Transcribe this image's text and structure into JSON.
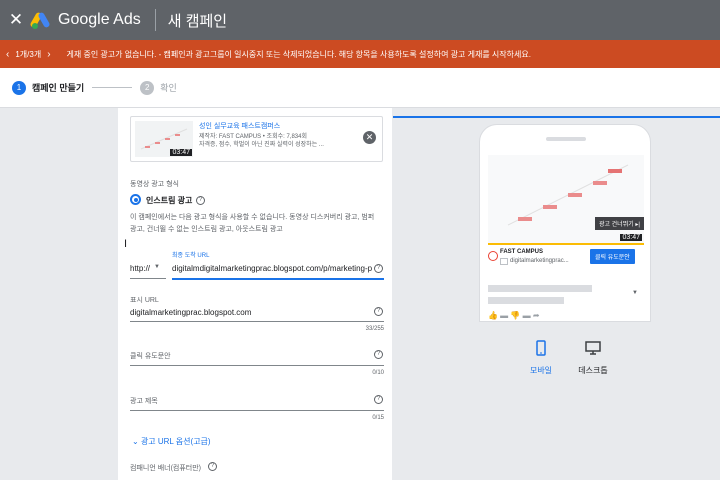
{
  "topbar": {
    "close_icon": "close-icon",
    "logo_icon": "google-ads-logo",
    "app_name": "Google Ads",
    "page_title": "새 캠페인"
  },
  "alert": {
    "prev": "‹",
    "count": "1개/3개",
    "next": "›",
    "message": "게재 중인 광고가 없습니다. - 캠페인과 광고그룹이 일시중지 또는 삭제되었습니다. 해당 항목을 사용하도록 설정하여 광고 게재를 시작하세요.",
    "background": "#cc4b22"
  },
  "steps": [
    {
      "number": "1",
      "label": "캠페인 만들기",
      "active": true
    },
    {
      "number": "2",
      "label": "확인",
      "active": false
    }
  ],
  "video": {
    "title": "성인 실무교육 패스트캠퍼스",
    "meta": "제작자: FAST CAMPUS • 조회수: 7,834회",
    "description": "자격증, 점수, 학벌이 아닌 진짜 실력이 성장하는 ...",
    "duration": "03:47"
  },
  "format": {
    "section_label": "동영상 광고 형식",
    "option_label": "인스트림 광고",
    "info": "이 캠페인에서는 다음 광고 형식을 사용할 수 없습니다. 동영상 디스커버리 광고, 범퍼 광고, 건너뛸 수 없는 인스트림 광고, 아웃스트림 광고"
  },
  "final_url": {
    "label": "최종 도착 URL",
    "protocol": "http://",
    "value": "digitalmdigitalmarketingprac.blogspot.com/p/marketing-p"
  },
  "display_url": {
    "label": "표시 URL",
    "value": "digitalmarketingprac.blogspot.com",
    "counter": "33/255"
  },
  "cta": {
    "label": "클릭 유도문안",
    "counter": "0/10"
  },
  "headline": {
    "label": "광고 제목",
    "counter": "0/15"
  },
  "advanced_link": "광고 URL 옵션(고급)",
  "companion_label": "컴패니언 배너(컴퓨터만)",
  "preview": {
    "skip": "광고 건너뛰기",
    "time": "03:47",
    "brand": "FAST CAMPUS",
    "domain": "digitalmarketingprac...",
    "cta_button": "클릭 유도문안"
  },
  "devices": {
    "mobile": "모바일",
    "desktop": "데스크톱"
  },
  "colors": {
    "accent": "#1a73e8",
    "topbar": "#5f6368"
  }
}
